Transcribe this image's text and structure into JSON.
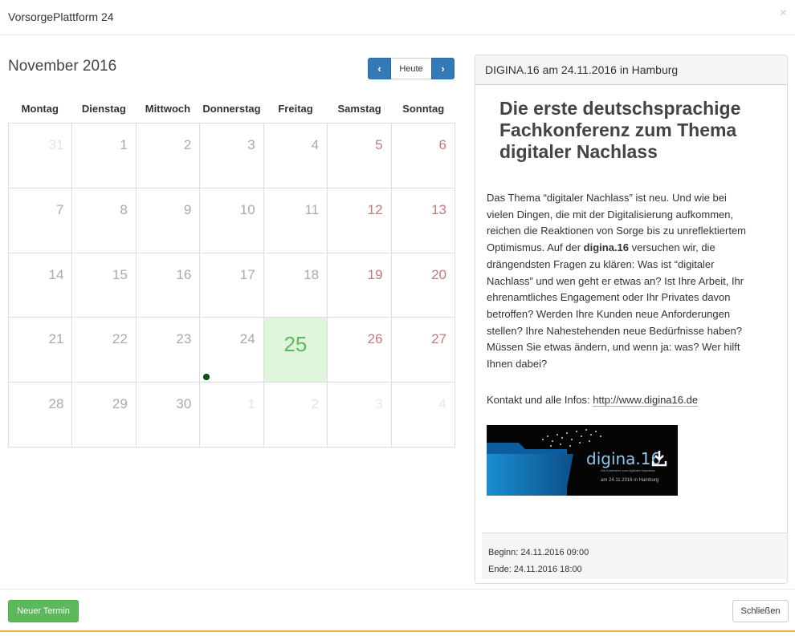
{
  "window": {
    "title": "VorsorgePlattform 24",
    "close_glyph": "×"
  },
  "calendar": {
    "month_title": "November 2016",
    "nav": {
      "prev_glyph": "‹",
      "today_label": "Heute",
      "next_glyph": "›"
    },
    "weekdays": [
      "Montag",
      "Dienstag",
      "Mittwoch",
      "Donnerstag",
      "Freitag",
      "Samstag",
      "Sonntag"
    ],
    "days": [
      {
        "d": "31",
        "muted": true
      },
      {
        "d": "1"
      },
      {
        "d": "2"
      },
      {
        "d": "3"
      },
      {
        "d": "4"
      },
      {
        "d": "5"
      },
      {
        "d": "6"
      },
      {
        "d": "7"
      },
      {
        "d": "8"
      },
      {
        "d": "9"
      },
      {
        "d": "10"
      },
      {
        "d": "11"
      },
      {
        "d": "12"
      },
      {
        "d": "13"
      },
      {
        "d": "14"
      },
      {
        "d": "15"
      },
      {
        "d": "16"
      },
      {
        "d": "17"
      },
      {
        "d": "18"
      },
      {
        "d": "19"
      },
      {
        "d": "20"
      },
      {
        "d": "21"
      },
      {
        "d": "22"
      },
      {
        "d": "23"
      },
      {
        "d": "24",
        "event": true
      },
      {
        "d": "25",
        "today": true
      },
      {
        "d": "26"
      },
      {
        "d": "27"
      },
      {
        "d": "28"
      },
      {
        "d": "29"
      },
      {
        "d": "30"
      },
      {
        "d": "1",
        "muted": true
      },
      {
        "d": "2",
        "muted": true
      },
      {
        "d": "3",
        "muted": true
      },
      {
        "d": "4",
        "muted": true
      }
    ],
    "colors": {
      "today_bg": "#dff5dc",
      "today_text": "#5cb85c",
      "weekend_text": "#c07c7c",
      "event_dot": "#0a5a0a"
    }
  },
  "event_panel": {
    "heading": "DIGINA.16 am 24.11.2016 in Hamburg",
    "title": "Die erste deutschsprachige Fachkonferenz zum Thema digitaler Nachlass",
    "text_part1": "Das Thema “digitaler Nachlass” ist neu. Und wie bei vielen Dingen, die mit der Digitalisierung aufkommen, reichen die Reaktionen von Sorge bis zu unreflektiertem Optimismus. Auf der ",
    "text_bold": "digina.16",
    "text_part2": " versuchen wir, die drängendsten Fragen zu klären: Was ist “digitaler Nachlass” und wen geht er etwas an? Ist Ihre Arbeit, Ihr ehrenamtliches Engagement oder Ihr Privates davon betroffen? Werden Ihre Kunden neue Anforderungen stellen? Ihre Nahestehenden neue Bedürfnisse haben? Müssen Sie etwas ändern, und wenn ja: was? Wer hilft Ihnen dabei?",
    "contact_label": "Kontakt und alle Infos: ",
    "contact_link": "http://www.digina16.de",
    "banner": {
      "logo_text": "digina.16",
      "tagline": "Die Konferenz zum digitalen Nachlass",
      "date_line": "am 24.11.2016 in Hamburg"
    },
    "begin": "Beginn: 24.11.2016 09:00",
    "end": "Ende: 24.11.2016 18:00"
  },
  "footer": {
    "new_button": "Neuer Termin",
    "close_button": "Schließen"
  },
  "colors": {
    "primary": "#337ab7",
    "success": "#5cb85c",
    "accent_line": "#f0ad4e"
  }
}
